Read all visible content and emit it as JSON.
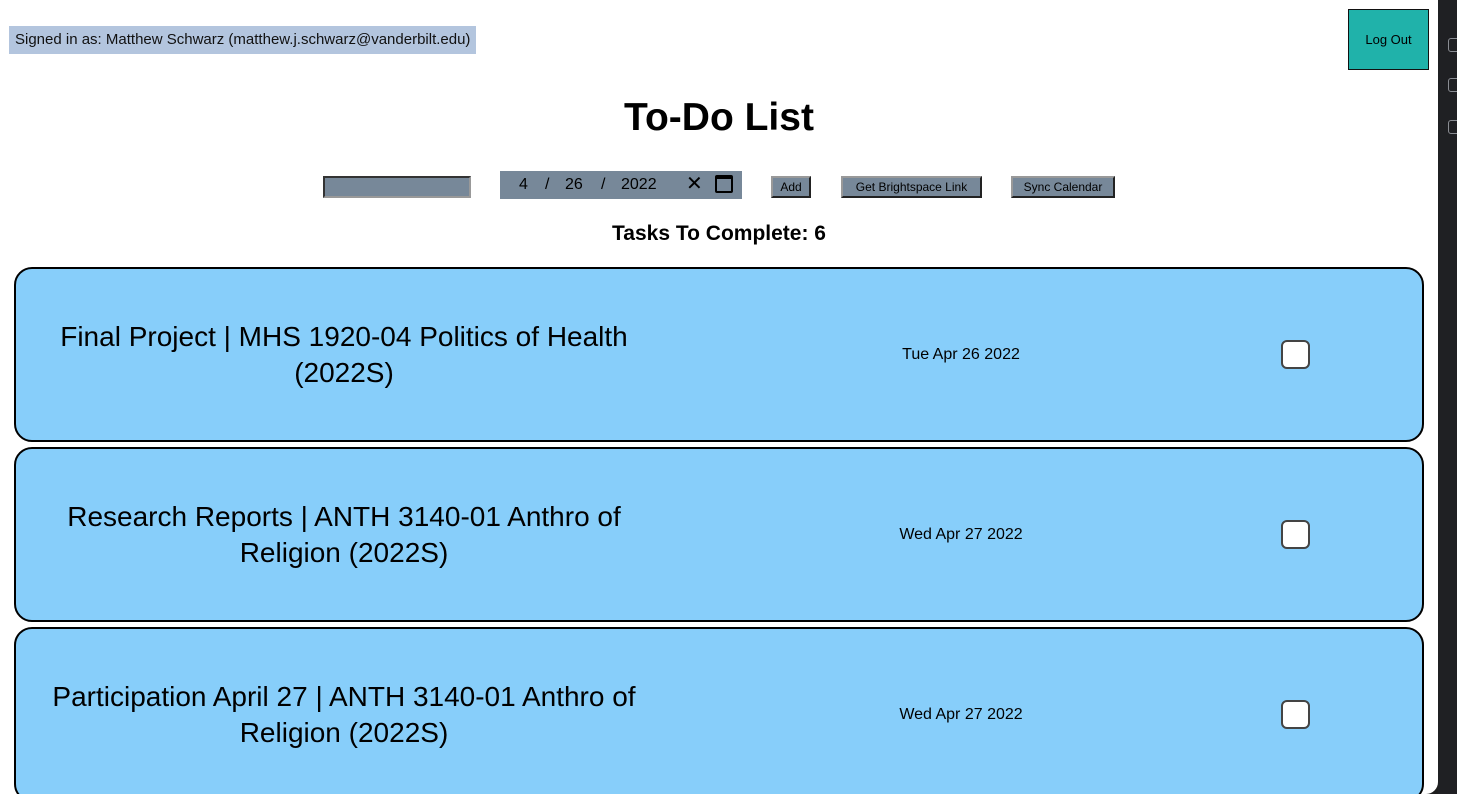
{
  "header": {
    "signed_in_text": "Signed in as: Matthew Schwarz (matthew.j.schwarz@vanderbilt.edu)",
    "logout_label": "Log Out",
    "title": "To-Do List"
  },
  "controls": {
    "task_input_value": "",
    "date": {
      "month": "4",
      "separator": "/",
      "day": "26",
      "year": "2022",
      "clear_glyph": "✕",
      "calendar_icon": "calendar-icon"
    },
    "add_label": "Add",
    "brightspace_label": "Get Brightspace Link",
    "sync_label": "Sync Calendar"
  },
  "summary": {
    "tasks_to_complete": "Tasks To Complete: 6"
  },
  "tasks": [
    {
      "title": "Final Project | MHS 1920-04 Politics of Health (2022S)",
      "due": "Tue Apr 26 2022",
      "completed": false
    },
    {
      "title": "Research Reports | ANTH 3140-01 Anthro of Religion (2022S)",
      "due": "Wed Apr 27 2022",
      "completed": false
    },
    {
      "title": "Participation April 27 | ANTH 3140-01 Anthro of Religion (2022S)",
      "due": "Wed Apr 27 2022",
      "completed": false
    }
  ],
  "colors": {
    "card_background": "#87cefa",
    "logout_button": "#20b2aa",
    "control_background": "#778899",
    "signed_in_background": "#b3c5de"
  }
}
